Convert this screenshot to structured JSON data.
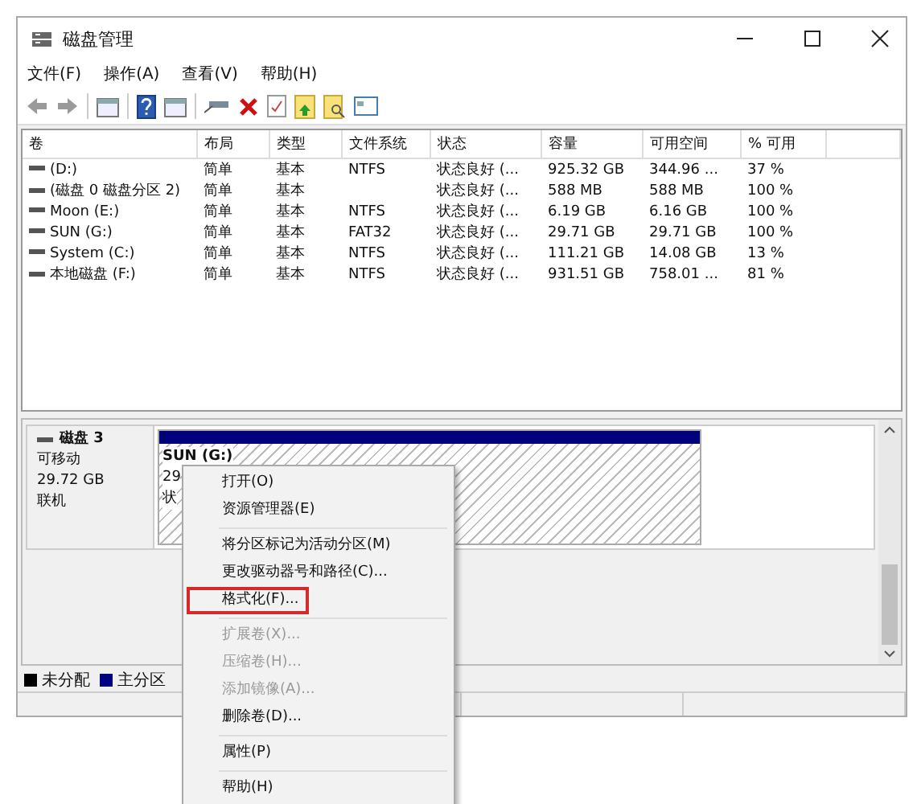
{
  "window": {
    "title": "磁盘管理"
  },
  "menu_bar": [
    "文件(F)",
    "操作(A)",
    "查看(V)",
    "帮助(H)"
  ],
  "table": {
    "columns": [
      "卷",
      "布局",
      "类型",
      "文件系统",
      "状态",
      "容量",
      "可用空间",
      "% 可用"
    ],
    "rows": [
      [
        "(D:)",
        "简单",
        "基本",
        "NTFS",
        "状态良好 (...",
        "925.32 GB",
        "344.96 ...",
        "37 %"
      ],
      [
        "(磁盘 0 磁盘分区 2)",
        "简单",
        "基本",
        "",
        "状态良好 (...",
        "588 MB",
        "588 MB",
        "100 %"
      ],
      [
        "Moon (E:)",
        "简单",
        "基本",
        "NTFS",
        "状态良好 (...",
        "6.19 GB",
        "6.16 GB",
        "100 %"
      ],
      [
        "SUN (G:)",
        "简单",
        "基本",
        "FAT32",
        "状态良好 (...",
        "29.71 GB",
        "29.71 GB",
        "100 %"
      ],
      [
        "System (C:)",
        "简单",
        "基本",
        "NTFS",
        "状态良好 (...",
        "111.21 GB",
        "14.08 GB",
        "13 %"
      ],
      [
        "本地磁盘 (F:)",
        "简单",
        "基本",
        "NTFS",
        "状态良好 (...",
        "931.51 GB",
        "758.01 ...",
        "81 %"
      ]
    ]
  },
  "disk": {
    "name": "磁盘 3",
    "type": "可移动",
    "size": "29.72 GB",
    "state": "联机",
    "partition": {
      "title": "SUN (G:)",
      "line_2": "29",
      "line_3": "状"
    }
  },
  "legend": [
    {
      "label": "未分配",
      "color": "#000000"
    },
    {
      "label": "主分区",
      "color": "#000080"
    }
  ],
  "context_menu": [
    {
      "kind": "item",
      "label": "打开(O)",
      "disabled": false,
      "boxed": false
    },
    {
      "kind": "item",
      "label": "资源管理器(E)",
      "disabled": false,
      "boxed": false
    },
    {
      "kind": "separator"
    },
    {
      "kind": "item",
      "label": "将分区标记为活动分区(M)",
      "disabled": false,
      "boxed": false
    },
    {
      "kind": "item",
      "label": "更改驱动器号和路径(C)...",
      "disabled": false,
      "boxed": false
    },
    {
      "kind": "item",
      "label": "格式化(F)...",
      "disabled": false,
      "boxed": true
    },
    {
      "kind": "separator"
    },
    {
      "kind": "item",
      "label": "扩展卷(X)...",
      "disabled": true,
      "boxed": false
    },
    {
      "kind": "item",
      "label": "压缩卷(H)...",
      "disabled": true,
      "boxed": false
    },
    {
      "kind": "item",
      "label": "添加镜像(A)...",
      "disabled": true,
      "boxed": false
    },
    {
      "kind": "item",
      "label": "删除卷(D)...",
      "disabled": false,
      "boxed": false
    },
    {
      "kind": "separator"
    },
    {
      "kind": "item",
      "label": "属性(P)",
      "disabled": false,
      "boxed": false
    },
    {
      "kind": "separator"
    },
    {
      "kind": "item",
      "label": "帮助(H)",
      "disabled": false,
      "boxed": false
    }
  ]
}
